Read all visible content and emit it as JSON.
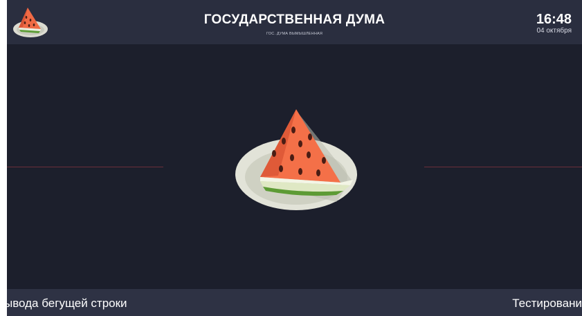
{
  "header": {
    "title": "ГОСУДАРСТВЕННАЯ ДУМА",
    "subtitle": "ГОС. ДУМА ВЫМЫШЛЕННАЯ",
    "time": "16:48",
    "date": "04 октября"
  },
  "icons": {
    "logo": "watermelon-logo-icon",
    "center": "watermelon-plate-icon"
  },
  "footer": {
    "ticker_left": "ывода бегущей строки",
    "ticker_right": "Тестировани"
  },
  "colors": {
    "background": "#1c1f2c",
    "header": "#2a2e3f",
    "footer": "#2e3244",
    "divider": "#6b2f3a"
  }
}
